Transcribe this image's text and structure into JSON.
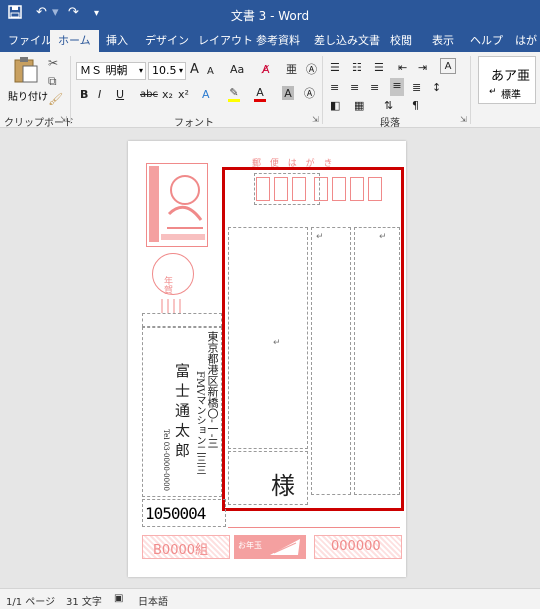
{
  "window": {
    "title": "文書 3  -  Word"
  },
  "qat": {
    "save_icon": "save-icon",
    "undo": "↶",
    "redo": "↷",
    "more": "▾"
  },
  "tabs": [
    {
      "label": "ファイル"
    },
    {
      "label": "ホーム"
    },
    {
      "label": "挿入"
    },
    {
      "label": "デザイン"
    },
    {
      "label": "レイアウト"
    },
    {
      "label": "参考資料"
    },
    {
      "label": "差し込み文書"
    },
    {
      "label": "校閲"
    },
    {
      "label": "表示"
    },
    {
      "label": "ヘルプ"
    },
    {
      "label": "はがき"
    }
  ],
  "ribbon": {
    "clipboard": {
      "paste_label": "貼り付け",
      "group_label": "クリップボード"
    },
    "font": {
      "font_name": "ＭＳ 明朝",
      "font_size": "10.5",
      "group_label": "フォント",
      "grow": "A",
      "shrink": "A",
      "case": "Aa",
      "bold": "B",
      "italic": "I",
      "underline": "U",
      "strike": "abc",
      "sub": "x₂",
      "sup": "x²",
      "highlight_color": "#ffff00",
      "font_color": "#e00000"
    },
    "paragraph": {
      "group_label": "段落"
    },
    "styles": {
      "sample": "あア亜",
      "name": "標準"
    }
  },
  "postcard": {
    "header": "郵 便 は が き",
    "recipient_title": "様",
    "sender_address": "東京都港区新橋〇-一-三",
    "sender_building": "FMVマンション二三三",
    "sender_name": "富 士 通   太 郎",
    "sender_tel": "Tel 03-0000-0000",
    "sender_postal": "1050004",
    "lottery_group": "B0000組",
    "lottery_number": "000000",
    "nenga": "年賀",
    "omikuji": "お年玉"
  },
  "status": {
    "page": "1/1 ページ",
    "words": "31 文字",
    "lang": "日本語"
  },
  "colors": {
    "brand": "#2b579a",
    "selection": "#cc0000",
    "stamp": "#f08a8a"
  }
}
